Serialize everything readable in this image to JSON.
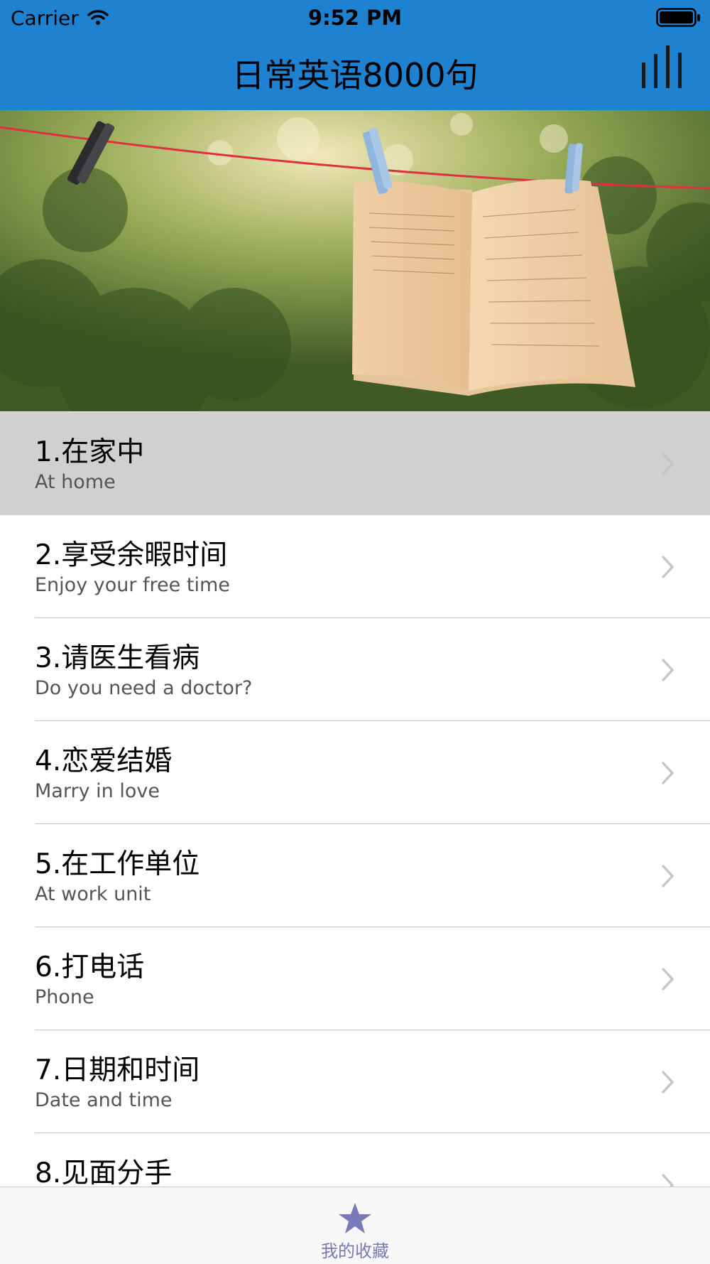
{
  "status_bar": {
    "carrier": "Carrier",
    "time": "9:52 PM"
  },
  "header": {
    "title": "日常英语8000句",
    "right_icon": "stats-bars-icon",
    "background_color": "#1f82d0"
  },
  "banner": {
    "description_icon": "book-on-clothesline-image"
  },
  "list": {
    "items": [
      {
        "title": "1.在家中",
        "subtitle": "At home",
        "selected": true
      },
      {
        "title": "2.享受余暇时间",
        "subtitle": "Enjoy your free time"
      },
      {
        "title": "3.请医生看病",
        "subtitle": "Do you need a doctor?"
      },
      {
        "title": "4.恋爱结婚",
        "subtitle": "Marry in love"
      },
      {
        "title": "5.在工作单位",
        "subtitle": "At work unit"
      },
      {
        "title": "6.打电话",
        "subtitle": "Phone"
      },
      {
        "title": "7.日期和时间",
        "subtitle": "Date and time"
      },
      {
        "title": "8.见面分手",
        "subtitle": ""
      }
    ]
  },
  "tab_bar": {
    "favorites_label": "我的收藏",
    "favorites_icon": "star-icon",
    "accent_color": "#7a7ab8"
  }
}
